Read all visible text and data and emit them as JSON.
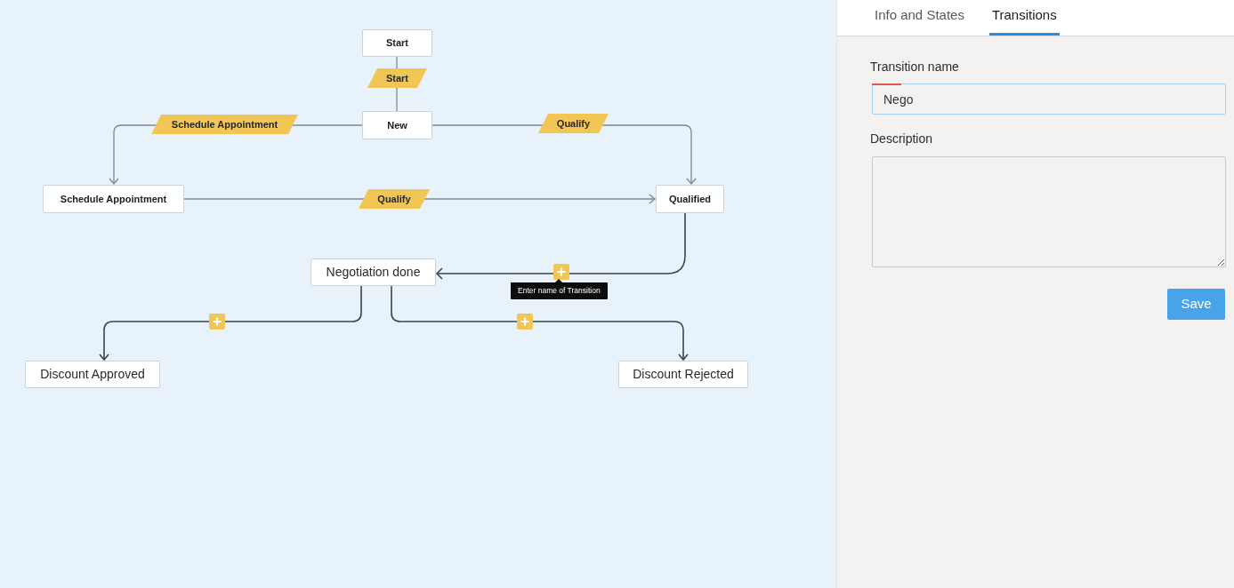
{
  "canvas": {
    "states": [
      {
        "kind": "saved",
        "label": "Start"
      },
      {
        "kind": "saved",
        "label": "New"
      },
      {
        "kind": "saved",
        "label": "Schedule Appointment"
      },
      {
        "kind": "saved",
        "label": "Qualified"
      },
      {
        "kind": "new",
        "label": "Negotiation done"
      },
      {
        "kind": "new",
        "label": "Discount Approved"
      },
      {
        "kind": "new",
        "label": "Discount Rejected"
      }
    ],
    "transitions": [
      {
        "kind": "named",
        "label": "Start"
      },
      {
        "kind": "named",
        "label": "Schedule Appointment"
      },
      {
        "kind": "named",
        "label": "Qualify"
      },
      {
        "kind": "named",
        "label": "Qualify"
      },
      {
        "kind": "unnamed",
        "tooltip": "Enter name of Transition"
      },
      {
        "kind": "unnamed"
      },
      {
        "kind": "unnamed"
      }
    ]
  },
  "panel": {
    "tabs": [
      {
        "label": "Info and States",
        "selected": false
      },
      {
        "label": "Transitions",
        "selected": true
      }
    ],
    "fields": [
      {
        "kind": "input",
        "label": "Transition name",
        "value": "Nego",
        "focused": true
      },
      {
        "kind": "textarea",
        "label": "Description"
      }
    ],
    "save_button": "Save"
  }
}
